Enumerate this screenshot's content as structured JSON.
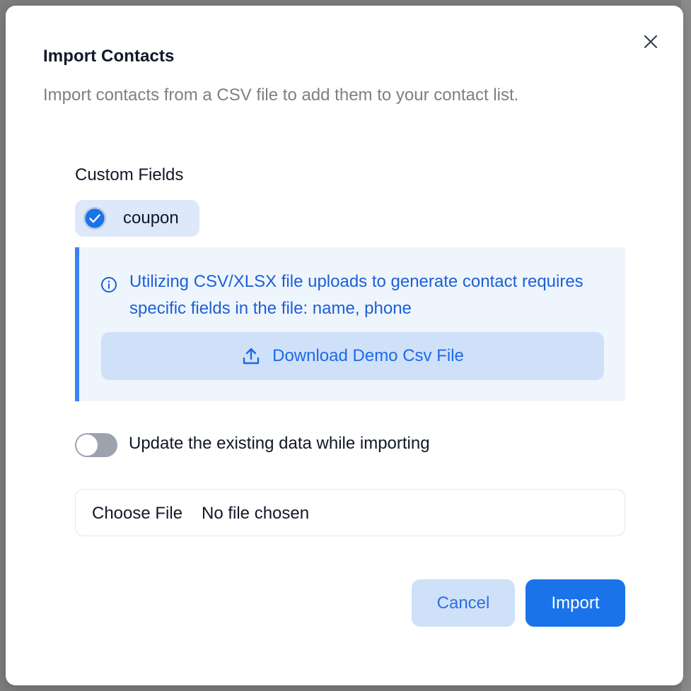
{
  "dialog": {
    "title": "Import Contacts",
    "subtitle": "Import contacts from a CSV file to add them to your contact list.",
    "close_icon": "close-icon"
  },
  "custom_fields": {
    "label": "Custom Fields",
    "items": [
      {
        "label": "coupon",
        "checked": true,
        "icon": "check-circle-icon"
      }
    ]
  },
  "info": {
    "icon": "info-icon",
    "text": "Utilizing CSV/XLSX file uploads to generate contact requires specific fields in the file: name, phone",
    "download_label": "Download Demo Csv File",
    "download_icon": "upload-icon"
  },
  "update_toggle": {
    "label": "Update the existing data while importing",
    "enabled": false
  },
  "file_input": {
    "button_label": "Choose File",
    "status": "No file chosen"
  },
  "actions": {
    "cancel_label": "Cancel",
    "import_label": "Import"
  },
  "colors": {
    "primary": "#1a73e8",
    "primary_light": "#cfe0f9",
    "info_bg": "#eff5fd",
    "info_border": "#3b82f6",
    "info_text": "#1d5fd6",
    "toggle_off": "#9ca3af"
  }
}
